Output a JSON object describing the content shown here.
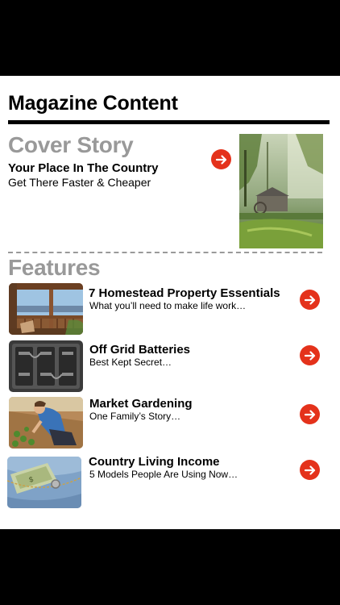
{
  "page": {
    "title": "Magazine Content"
  },
  "cover": {
    "heading": "Cover Story",
    "title": "Your Place In The Country",
    "subtitle": "Get There Faster & Cheaper",
    "image_icon": "mill-forest-photo"
  },
  "features": {
    "heading": "Features",
    "items": [
      {
        "title": "7 Homestead Property Essentials",
        "subtitle": "What you’ll need to make life work…",
        "image_icon": "porch-view-photo"
      },
      {
        "title": "Off Grid Batteries",
        "subtitle": "Best Kept Secret…",
        "image_icon": "battery-bank-photo"
      },
      {
        "title": "Market Gardening",
        "subtitle": "One Family’s Story…",
        "image_icon": "gardener-photo"
      },
      {
        "title": "Country Living Income",
        "subtitle": "5 Models People Are Using Now…",
        "image_icon": "denim-pocket-money-photo"
      }
    ]
  },
  "colors": {
    "accent": "#e4321b",
    "heading_gray": "#999999"
  }
}
